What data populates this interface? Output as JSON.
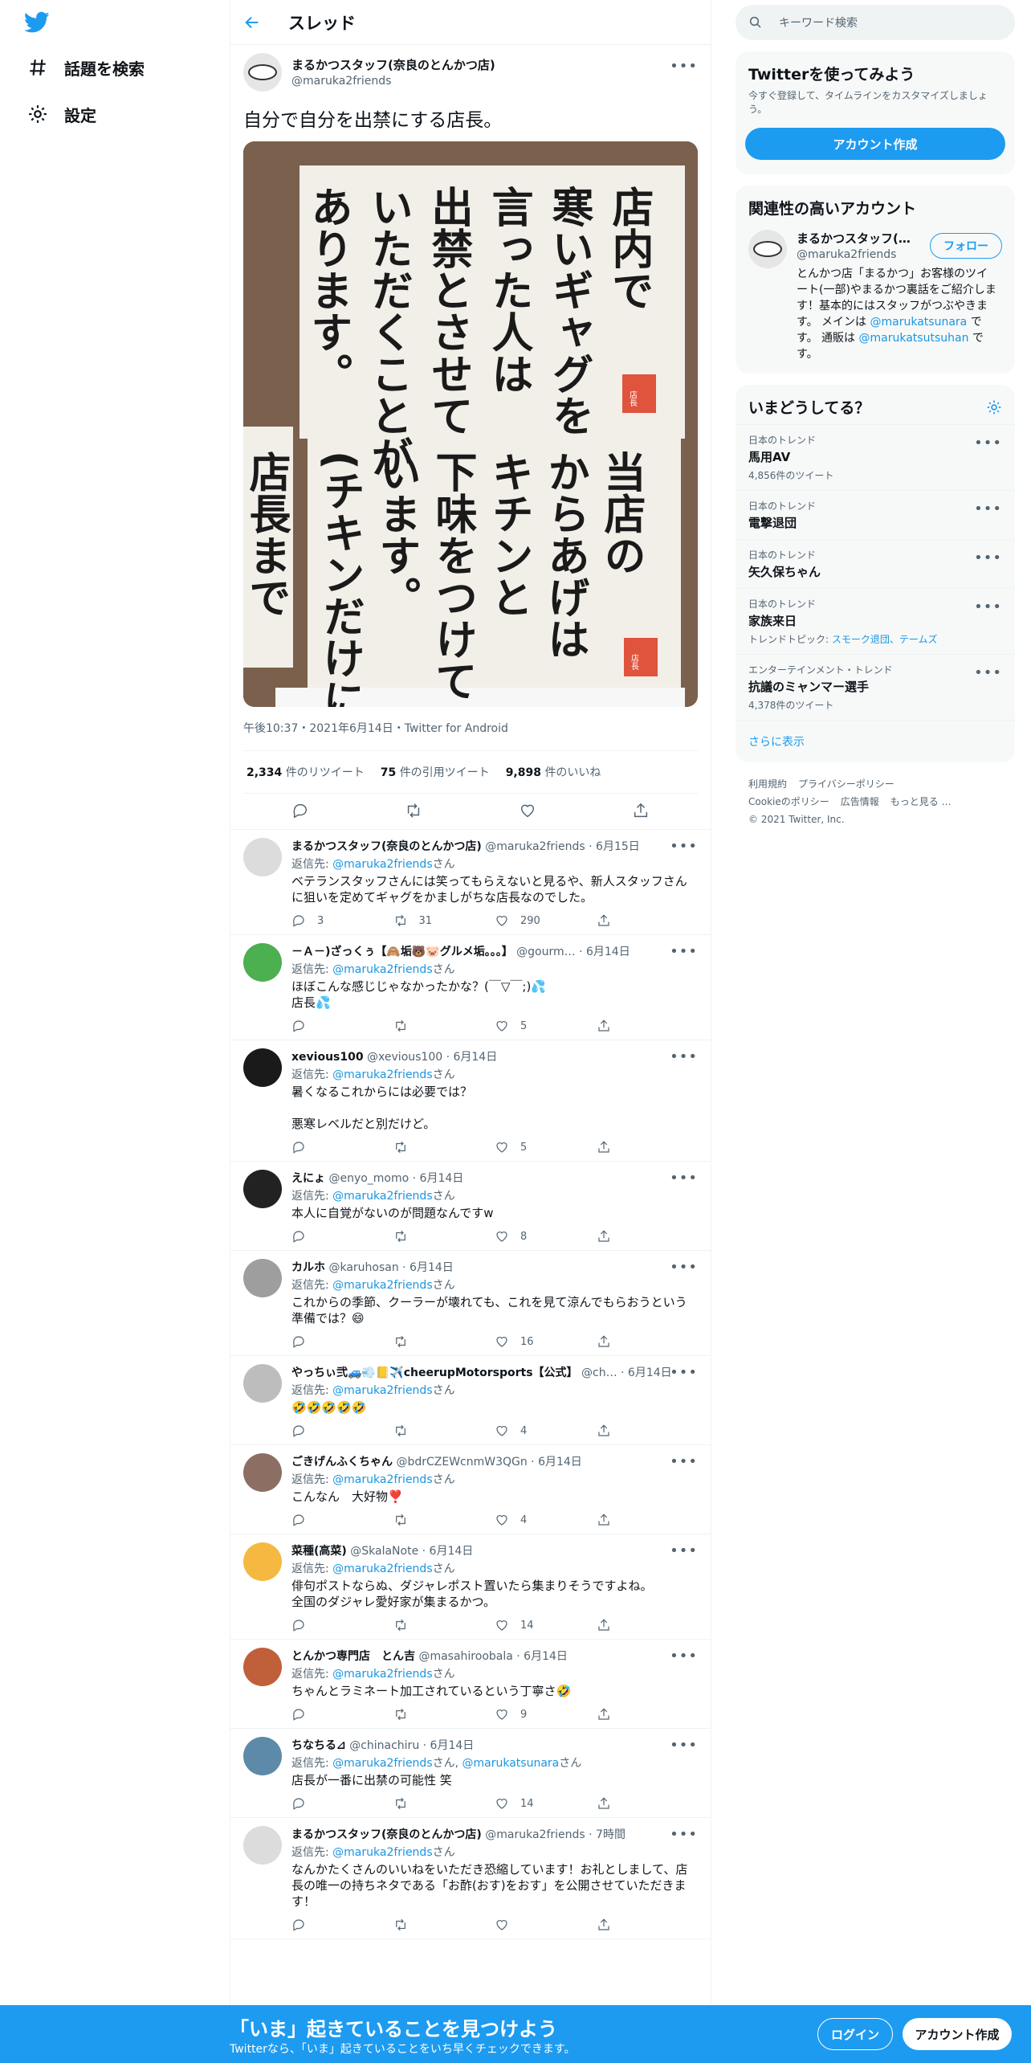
{
  "nav": {
    "explore_label": "話題を検索",
    "settings_label": "設定"
  },
  "header": {
    "title": "スレッド"
  },
  "main_tweet": {
    "name": "まるかつスタッフ(奈良のとんかつ店)",
    "handle": "@maruka2friends",
    "text": "自分で自分を出禁にする店長。",
    "meta": "午後10:37・2021年6月14日・Twitter for Android",
    "retweets": "2,334",
    "retweets_label": "件のリツイート",
    "quotes": "75",
    "quotes_label": "件の引用ツイート",
    "likes": "9,898",
    "likes_label": "件のいいね"
  },
  "photo_text": {
    "upper": "店内で寒いギャグを言った人は出禁とさせていただくことがあります。",
    "lower": "当店のからあげはキチンと下味をつけています。(チキンだけに)",
    "stamp": "店長"
  },
  "replies": [
    {
      "name": "まるかつスタッフ(奈良のとんかつ店)",
      "handle": "@maruka2friends · 6月15日",
      "to": "@maruka2friends",
      "to_suffix": "さん",
      "text": "ベテランスタッフさんには笑ってもらえないと見るや、新人スタッフさんに狙いを定めてギャグをかましがちな店長なのでした。",
      "reply": "3",
      "rt": "31",
      "like": "290",
      "color": "#dcdcdc"
    },
    {
      "name": "－Ａ－)ざっくぅ【🙈垢🐻🐷グルメ垢。。。】",
      "handle": "@gourm… · 6月14日",
      "to": "@maruka2friends",
      "to_suffix": "さん",
      "text": "ほぼこんな感じじゃなかったかな？(￣▽￣;)💦\n店長💦",
      "reply": "",
      "rt": "",
      "like": "5",
      "color": "#4caf50"
    },
    {
      "name": "xevious100",
      "handle": "@xevious100 · 6月14日",
      "to": "@maruka2friends",
      "to_suffix": "さん",
      "text": "暑くなるこれからには必要では？\n\n悪寒レベルだと別だけど。",
      "reply": "",
      "rt": "",
      "like": "5",
      "color": "#1a1a1a"
    },
    {
      "name": "えにょ",
      "handle": "@enyo_momo · 6月14日",
      "to": "@maruka2friends",
      "to_suffix": "さん",
      "text": "本人に自覚がないのが問題なんですw",
      "reply": "",
      "rt": "",
      "like": "8",
      "color": "#222222"
    },
    {
      "name": "カルホ",
      "handle": "@karuhosan · 6月14日",
      "to": "@maruka2friends",
      "to_suffix": "さん",
      "text": "これからの季節、クーラーが壊れても、これを見て涼んでもらおうという準備では？😄",
      "reply": "",
      "rt": "",
      "like": "16",
      "color": "#9e9e9e"
    },
    {
      "name": "やっちぃ弐🚙💨📒✈️cheerupMotorsports【公式】",
      "handle": "@ch… · 6月14日",
      "to": "@maruka2friends",
      "to_suffix": "さん",
      "text": "🤣🤣🤣🤣🤣",
      "reply": "",
      "rt": "",
      "like": "4",
      "color": "#bdbdbd"
    },
    {
      "name": "ごきげんふくちゃん",
      "handle": "@bdrCZEWcnmW3QGn · 6月14日",
      "to": "@maruka2friends",
      "to_suffix": "さん",
      "text": "こんなん　大好物❣️",
      "reply": "",
      "rt": "",
      "like": "4",
      "color": "#8d6e63"
    },
    {
      "name": "菜種(高菜)",
      "handle": "@SkalaNote · 6月14日",
      "to": "@maruka2friends",
      "to_suffix": "さん",
      "text": "俳句ポストならぬ、ダジャレポスト置いたら集まりそうですよね。\n全国のダジャレ愛好家が集まるかつ。",
      "reply": "",
      "rt": "",
      "like": "14",
      "color": "#f5b942"
    },
    {
      "name": "とんかつ専門店　とん吉",
      "handle": "@masahiroobala · 6月14日",
      "to": "@maruka2friends",
      "to_suffix": "さん",
      "text": "ちゃんとラミネート加工されているという丁寧さ🤣",
      "reply": "",
      "rt": "",
      "like": "9",
      "color": "#c0603a"
    },
    {
      "name": "ちなちる⊿",
      "handle": "@chinachiru · 6月14日",
      "to": "@maruka2friends",
      "to_suffix": "さん, ",
      "to2": "@marukatsunara",
      "to2_suffix": "さん",
      "text": "店長が一番に出禁の可能性 笑",
      "reply": "",
      "rt": "",
      "like": "14",
      "color": "#5d8aa8"
    },
    {
      "name": "まるかつスタッフ(奈良のとんかつ店)",
      "handle": "@maruka2friends · 7時間",
      "to": "@maruka2friends",
      "to_suffix": "さん",
      "text": "なんかたくさんのいいねをいただき恐縮しています！お礼としまして、店長の唯一の持ちネタである「お酢(おす)をおす」を公開させていただきます！",
      "reply": "",
      "rt": "",
      "like": "",
      "color": "#dcdcdc"
    }
  ],
  "replies_prefix": "返信先: ",
  "sidebar": {
    "search_placeholder": "キーワード検索",
    "signup_title": "Twitterを使ってみよう",
    "signup_text": "今すぐ登録して、タイムラインをカスタマイズしましょう。",
    "signup_button": "アカウント作成",
    "related_title": "関連性の高いアカウント",
    "related_name": "まるかつスタッフ(奈…",
    "related_handle": "@maruka2friends",
    "follow_label": "フォロー",
    "related_bio_1": "とんかつ店「まるかつ」お客様のツイート(一部)やまるかつ裏話をご紹介します！基本的にはスタッフがつぶやきます。 メインは ",
    "related_bio_link1": "@marukatsunara",
    "related_bio_2": " です。 通販は ",
    "related_bio_link2": "@marukatsutsuhan",
    "related_bio_3": " です。",
    "trends_title": "いまどうしてる？",
    "trends": [
      {
        "cat": "日本のトレンド",
        "title": "馬用AV",
        "count": "4,856件のツイート"
      },
      {
        "cat": "日本のトレンド",
        "title": "電撃退団",
        "count": ""
      },
      {
        "cat": "日本のトレンド",
        "title": "矢久保ちゃん",
        "count": ""
      },
      {
        "cat": "日本のトレンド",
        "title": "家族来日",
        "count": "トレンドトピック: ",
        "links": "スモーク退団、テームズ"
      },
      {
        "cat": "エンターテインメント・トレンド",
        "title": "抗議のミャンマー選手",
        "count": "4,378件のツイート"
      }
    ],
    "show_more": "さらに表示",
    "footer": [
      "利用規約",
      "プライバシーポリシー",
      "Cookieのポリシー",
      "広告情報",
      "もっと見る …",
      "© 2021 Twitter, Inc."
    ]
  },
  "bottom_bar": {
    "headline": "「いま」起きていることを見つけよう",
    "subtext": "Twitterなら、「いま」起きていることをいち早くチェックできます。",
    "login": "ログイン",
    "signup": "アカウント作成"
  },
  "colors": {
    "accent": "#1d9bf0",
    "text": "#0f1419",
    "muted": "#536471"
  }
}
